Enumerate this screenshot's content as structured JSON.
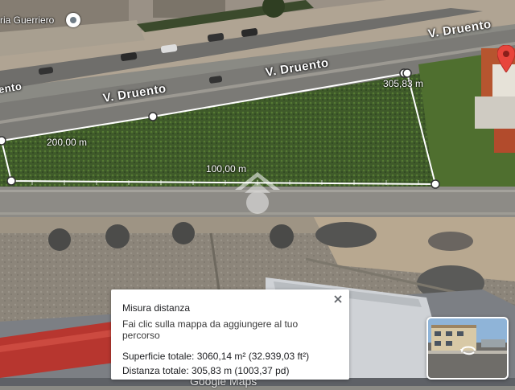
{
  "map": {
    "roads": [
      {
        "name": "V. Druento"
      },
      {
        "name": "V. Druento"
      },
      {
        "name": "V. Druento"
      },
      {
        "name": "ento"
      }
    ],
    "place_label": "ria Guerriero",
    "measure": {
      "segment_labels": [
        "200,00 m",
        "100,00 m",
        "305,83 m"
      ]
    },
    "pin_color": "#e8453c",
    "google_logo": "Google Maps"
  },
  "infobox": {
    "title": "Misura distanza",
    "hint": "Fai clic sulla mappa da aggiungere al tuo percorso",
    "area": "Superficie totale: 3060,14 m² (32.939,03 ft²)",
    "distance": "Distanza totale: 305,83 m (1003,37 pd)"
  }
}
